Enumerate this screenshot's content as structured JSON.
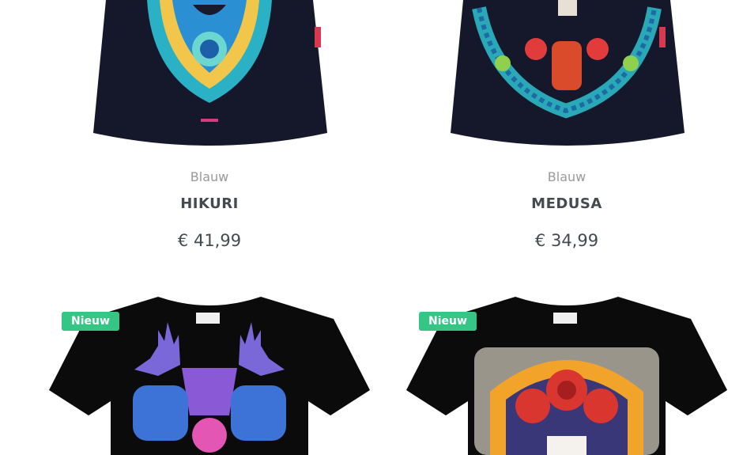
{
  "products": [
    {
      "color": "Blauw",
      "name": "HIKURI",
      "price": "€ 41,99",
      "shirt_color": "#14182a"
    },
    {
      "color": "Blauw",
      "name": "MEDUSA",
      "price": "€ 34,99",
      "shirt_color": "#14182a"
    },
    {
      "badge": "Nieuw",
      "shirt_color": "#0b0b0b"
    },
    {
      "badge": "Nieuw",
      "shirt_color": "#0b0b0b"
    }
  ],
  "colors": {
    "badge_bg": "#35c585",
    "text_muted": "#9a9a9a",
    "text_main": "#444a4f"
  },
  "icons": [
    "huichol-mask-print",
    "medusa-skull-print",
    "deer-antler-print",
    "roses-skull-print"
  ]
}
